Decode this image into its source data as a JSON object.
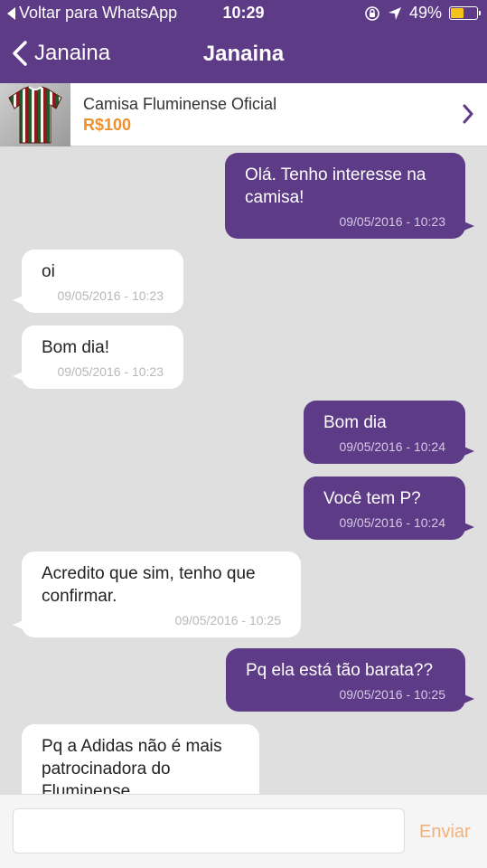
{
  "statusbar": {
    "back_app": "Voltar para WhatsApp",
    "time": "10:29",
    "battery": "49%",
    "battery_level": 0.49
  },
  "nav": {
    "back_label": "Janaina",
    "title": "Janaina"
  },
  "product": {
    "name": "Camisa Fluminense Oficial",
    "price": "R$100"
  },
  "messages": [
    {
      "dir": "out",
      "lines": [
        "Olá. Tenho interesse na",
        "camisa!"
      ],
      "time": "09/05/2016 - 10:23"
    },
    {
      "dir": "in",
      "lines": [
        "oi"
      ],
      "time": "09/05/2016 - 10:23"
    },
    {
      "dir": "in",
      "lines": [
        "Bom dia!"
      ],
      "time": "09/05/2016 - 10:23"
    },
    {
      "dir": "out",
      "lines": [
        "Bom dia"
      ],
      "time": "09/05/2016 - 10:24"
    },
    {
      "dir": "out",
      "lines": [
        "Você tem P?"
      ],
      "time": "09/05/2016 - 10:24"
    },
    {
      "dir": "in",
      "lines": [
        "Acredito que sim, tenho que",
        "confirmar."
      ],
      "time": "09/05/2016 - 10:25"
    },
    {
      "dir": "out",
      "lines": [
        "Pq ela está tão barata??"
      ],
      "time": "09/05/2016 - 10:25"
    },
    {
      "dir": "in",
      "lines": [
        "Pq a Adidas não é mais",
        "patrocinadora do",
        "Fluminense"
      ],
      "time": ""
    }
  ],
  "composer": {
    "placeholder": "",
    "send_label": "Enviar"
  },
  "colors": {
    "brand": "#5d3b86",
    "price": "#f0902c",
    "send": "#f0b27a",
    "chat_bg": "#e0dfe0"
  }
}
